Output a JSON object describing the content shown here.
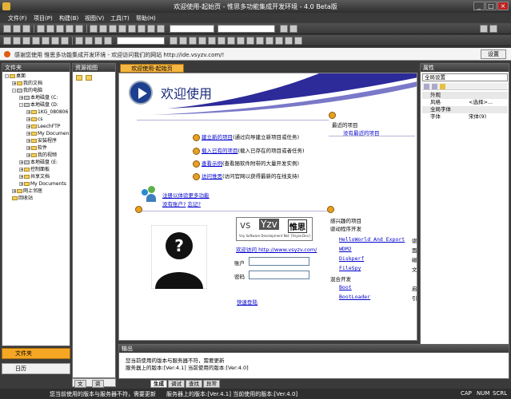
{
  "window": {
    "title": "欢迎使用-起始页 - 惟思多功能集成开发环境 - 4.0 Beta版",
    "controls": [
      "_",
      "□",
      "×"
    ]
  },
  "menu": [
    "文件(F)",
    "项目(P)",
    "构建(B)",
    "视图(V)",
    "工具(T)",
    "帮助(H)"
  ],
  "infobar": {
    "text": "感谢您使用 惟思多功能集成开发环境 - 欢迎访问我们的网站 http://ide.vsyzv.com/!",
    "button": "设置"
  },
  "folders_panel": {
    "title": "文件夹",
    "tree": [
      {
        "label": "桌面",
        "level": 0,
        "expander": "-",
        "icon": "folder"
      },
      {
        "label": "我的文档",
        "level": 1,
        "expander": "+",
        "icon": "folder"
      },
      {
        "label": "我的电脑",
        "level": 1,
        "expander": "-",
        "icon": "drive"
      },
      {
        "label": "本地磁盘 (C:",
        "level": 2,
        "expander": "+",
        "icon": "drive"
      },
      {
        "label": "本地磁盘 (D:",
        "level": 2,
        "expander": "-",
        "icon": "drive"
      },
      {
        "label": "1KG_080806",
        "level": 3,
        "expander": "+",
        "icon": "folder"
      },
      {
        "label": "cs",
        "level": 3,
        "expander": "+",
        "icon": "folder"
      },
      {
        "label": "LeechFTP",
        "level": 3,
        "expander": "+",
        "icon": "folder"
      },
      {
        "label": "My Documen",
        "level": 3,
        "expander": "+",
        "icon": "folder"
      },
      {
        "label": "安装程序",
        "level": 3,
        "expander": "+",
        "icon": "folder"
      },
      {
        "label": "软件",
        "level": 3,
        "expander": "+",
        "icon": "folder"
      },
      {
        "label": "我的视频",
        "level": 3,
        "expander": "+",
        "icon": "folder"
      },
      {
        "label": "本地磁盘 (E:",
        "level": 2,
        "expander": "+",
        "icon": "drive"
      },
      {
        "label": "控制面板",
        "level": 2,
        "expander": "+",
        "icon": "folder"
      },
      {
        "label": "共享文档",
        "level": 2,
        "expander": "+",
        "icon": "folder"
      },
      {
        "label": "My Documents",
        "level": 2,
        "expander": "+",
        "icon": "folder"
      },
      {
        "label": "网上邻居",
        "level": 1,
        "expander": "+",
        "icon": "folder"
      },
      {
        "label": "回收站",
        "level": 1,
        "expander": "",
        "icon": "folder"
      }
    ],
    "tabs": [
      "文件夹",
      "日历"
    ]
  },
  "resource_panel": {
    "title": "资源视图",
    "tabs": [
      "文",
      "资"
    ]
  },
  "document": {
    "tab": "欢迎使用-起始页",
    "welcome_title": "欢迎使用",
    "actions": [
      {
        "link": "建立新的项目",
        "desc": "(通过向导建立新项目或任务)"
      },
      {
        "link": "载入已有的项目",
        "desc": "(载入已存在的项目或者任务)"
      },
      {
        "link": "查看示例",
        "desc": "(查看随软件附带的大量开发实例)"
      },
      {
        "link": "访问惟思",
        "desc": "(访问官网以获得最新的在线支持)"
      }
    ],
    "recent": {
      "title": "最近的项目",
      "link": "没有最近的项目"
    },
    "register": {
      "link1": "注册以体验更多功能",
      "link2": "忘记?",
      "question": "没有账户?"
    },
    "vs_logo": {
      "text1": "vs",
      "text2": "Yzv",
      "cn": "惟思",
      "sub": "Vsy Software Development Net",
      "sub2": "[Vsyzv.Dev]"
    },
    "site_link": "欢迎访问 http://www.vsyzv.com/",
    "account_label": "账户",
    "password_label": "密码",
    "quick_login": "快速登陆",
    "interest": {
      "title": "感兴趣的项目",
      "subtitle": "驱动程序开发",
      "items": [
        "HelloWorld And Export",
        "WDM2",
        "Diskperf",
        "FileSpy"
      ],
      "subtitle2": "混合开发",
      "items2": [
        "Boot",
        "BootLoader"
      ],
      "side": [
        "驱",
        "面",
        "磁",
        "文",
        "启",
        "引"
      ]
    }
  },
  "properties_panel": {
    "title": "属性",
    "combo": "全局设置",
    "rows": [
      {
        "kind": "group",
        "key": "外观"
      },
      {
        "kind": "item",
        "key": "风格",
        "value": "<选择>..."
      },
      {
        "kind": "group",
        "key": "全局字体"
      },
      {
        "kind": "item",
        "key": "字体",
        "value": "宋体(9)"
      }
    ]
  },
  "output_panel": {
    "title": "输出",
    "lines": [
      "您当前使用的版本与服务器不符，需要更新",
      "服务器上的版本:[Ver:4.1] 当前使用的版本:[Ver:4.0]"
    ],
    "tabs": [
      "生成",
      "调试",
      "查找",
      "异常"
    ]
  },
  "statusbar": {
    "left": "您当前使用的版本与服务器不符，需要更新",
    "right": "服务器上的版本:[Ver.4.1] 当前使用的版本:[Ver.4.0]",
    "caps": "CAP",
    "num": "NUM",
    "scrl": "SCRL"
  },
  "colors": {
    "accent_orange": "#f5b642",
    "dark_chrome": "#3a3a3a",
    "link_blue": "#0000cc",
    "welcome_purple": "#2d2a9a"
  }
}
